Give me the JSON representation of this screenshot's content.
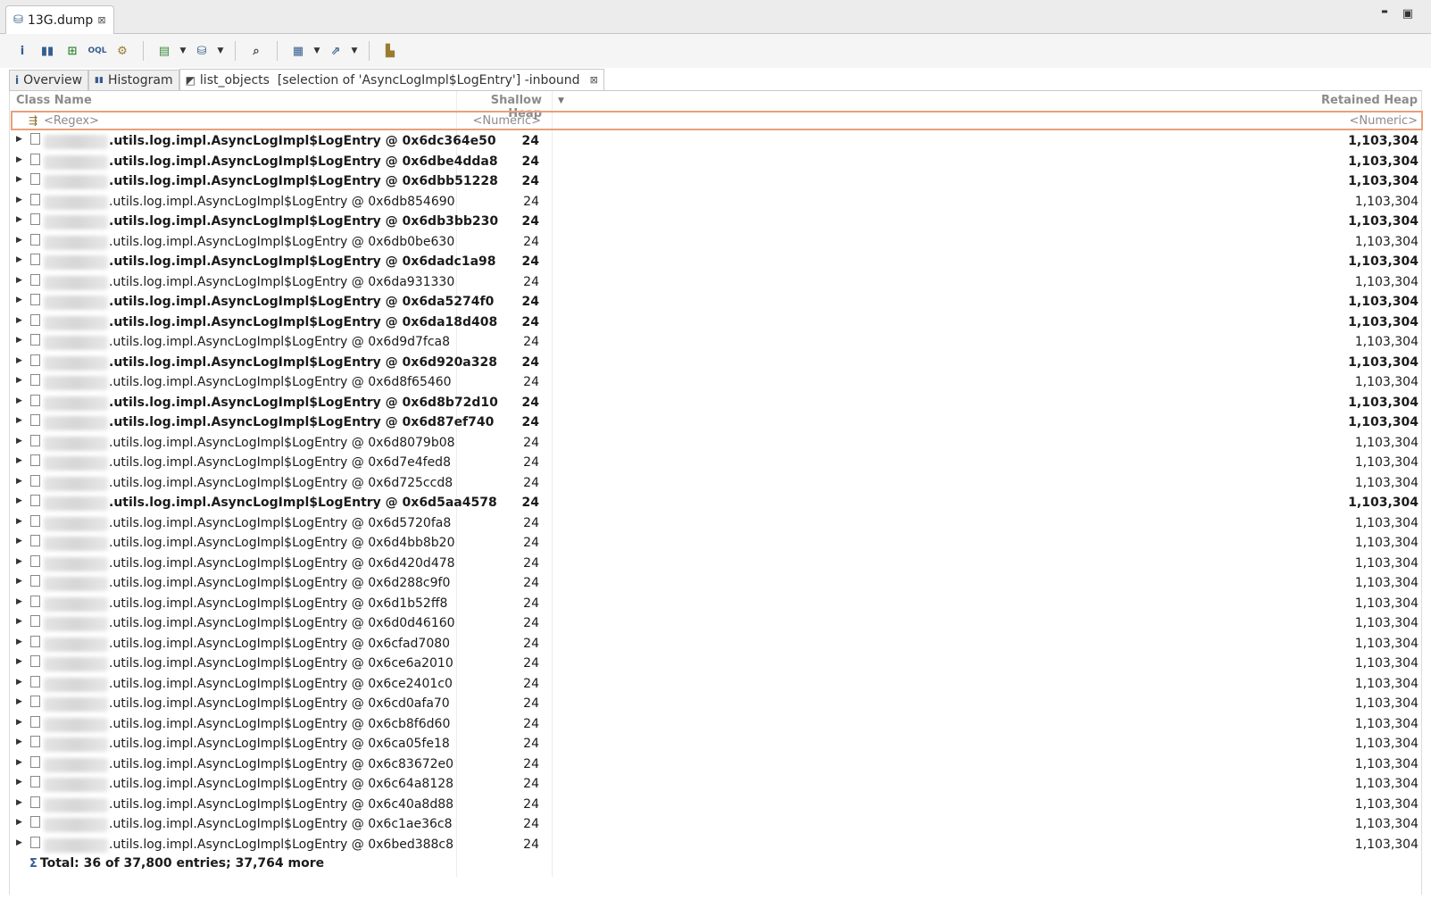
{
  "editor_tab": {
    "title": "13G.dump",
    "close": "⊠"
  },
  "window_controls": {
    "minimize": "▬",
    "maximize": "▣"
  },
  "toolbar": {
    "buttons": [
      "info-icon",
      "histogram-icon",
      "dominator-tree-icon",
      "oql-icon",
      "heap-dump-details-icon",
      "run-report-icon",
      "query-browser-icon",
      "find-object-icon",
      "calculator-icon",
      "export-icon",
      "group-icon"
    ]
  },
  "view_tabs": [
    {
      "icon": "i",
      "label": "Overview"
    },
    {
      "icon": "▮▮",
      "label": "Histogram"
    },
    {
      "icon": "◩",
      "label": "list_objects  [selection of 'AsyncLogImpl$LogEntry'] -inbound",
      "close": "⊠"
    }
  ],
  "table": {
    "headers": {
      "class_name": "Class Name",
      "shallow_heap": "Shallow Heap",
      "retained_heap": "Retained Heap",
      "sort_indicator": "▼"
    },
    "filters": {
      "class_name": "<Regex>",
      "shallow_heap": "<Numeric>",
      "retained_heap": "<Numeric>"
    },
    "rows": [
      {
        "cls": ".utils.log.impl.AsyncLogImpl$LogEntry @ 0x6dc364e50",
        "shallow": "24",
        "retained": "1,103,304",
        "bold": true
      },
      {
        "cls": ".utils.log.impl.AsyncLogImpl$LogEntry @ 0x6dbe4dda8",
        "shallow": "24",
        "retained": "1,103,304",
        "bold": true
      },
      {
        "cls": ".utils.log.impl.AsyncLogImpl$LogEntry @ 0x6dbb51228",
        "shallow": "24",
        "retained": "1,103,304",
        "bold": true
      },
      {
        "cls": ".utils.log.impl.AsyncLogImpl$LogEntry @ 0x6db854690",
        "shallow": "24",
        "retained": "1,103,304",
        "bold": false
      },
      {
        "cls": ".utils.log.impl.AsyncLogImpl$LogEntry @ 0x6db3bb230",
        "shallow": "24",
        "retained": "1,103,304",
        "bold": true
      },
      {
        "cls": ".utils.log.impl.AsyncLogImpl$LogEntry @ 0x6db0be630",
        "shallow": "24",
        "retained": "1,103,304",
        "bold": false
      },
      {
        "cls": ".utils.log.impl.AsyncLogImpl$LogEntry @ 0x6dadc1a98",
        "shallow": "24",
        "retained": "1,103,304",
        "bold": true
      },
      {
        "cls": ".utils.log.impl.AsyncLogImpl$LogEntry @ 0x6da931330",
        "shallow": "24",
        "retained": "1,103,304",
        "bold": false
      },
      {
        "cls": ".utils.log.impl.AsyncLogImpl$LogEntry @ 0x6da5274f0",
        "shallow": "24",
        "retained": "1,103,304",
        "bold": true
      },
      {
        "cls": ".utils.log.impl.AsyncLogImpl$LogEntry @ 0x6da18d408",
        "shallow": "24",
        "retained": "1,103,304",
        "bold": true
      },
      {
        "cls": ".utils.log.impl.AsyncLogImpl$LogEntry @ 0x6d9d7fca8",
        "shallow": "24",
        "retained": "1,103,304",
        "bold": false
      },
      {
        "cls": ".utils.log.impl.AsyncLogImpl$LogEntry @ 0x6d920a328",
        "shallow": "24",
        "retained": "1,103,304",
        "bold": true
      },
      {
        "cls": ".utils.log.impl.AsyncLogImpl$LogEntry @ 0x6d8f65460",
        "shallow": "24",
        "retained": "1,103,304",
        "bold": false
      },
      {
        "cls": ".utils.log.impl.AsyncLogImpl$LogEntry @ 0x6d8b72d10",
        "shallow": "24",
        "retained": "1,103,304",
        "bold": true
      },
      {
        "cls": ".utils.log.impl.AsyncLogImpl$LogEntry @ 0x6d87ef740",
        "shallow": "24",
        "retained": "1,103,304",
        "bold": true
      },
      {
        "cls": ".utils.log.impl.AsyncLogImpl$LogEntry @ 0x6d8079b08",
        "shallow": "24",
        "retained": "1,103,304",
        "bold": false
      },
      {
        "cls": ".utils.log.impl.AsyncLogImpl$LogEntry @ 0x6d7e4fed8",
        "shallow": "24",
        "retained": "1,103,304",
        "bold": false
      },
      {
        "cls": ".utils.log.impl.AsyncLogImpl$LogEntry @ 0x6d725ccd8",
        "shallow": "24",
        "retained": "1,103,304",
        "bold": false
      },
      {
        "cls": ".utils.log.impl.AsyncLogImpl$LogEntry @ 0x6d5aa4578",
        "shallow": "24",
        "retained": "1,103,304",
        "bold": true
      },
      {
        "cls": ".utils.log.impl.AsyncLogImpl$LogEntry @ 0x6d5720fa8",
        "shallow": "24",
        "retained": "1,103,304",
        "bold": false
      },
      {
        "cls": ".utils.log.impl.AsyncLogImpl$LogEntry @ 0x6d4bb8b20",
        "shallow": "24",
        "retained": "1,103,304",
        "bold": false
      },
      {
        "cls": ".utils.log.impl.AsyncLogImpl$LogEntry @ 0x6d420d478",
        "shallow": "24",
        "retained": "1,103,304",
        "bold": false
      },
      {
        "cls": ".utils.log.impl.AsyncLogImpl$LogEntry @ 0x6d288c9f0",
        "shallow": "24",
        "retained": "1,103,304",
        "bold": false
      },
      {
        "cls": ".utils.log.impl.AsyncLogImpl$LogEntry @ 0x6d1b52ff8",
        "shallow": "24",
        "retained": "1,103,304",
        "bold": false
      },
      {
        "cls": ".utils.log.impl.AsyncLogImpl$LogEntry @ 0x6d0d46160",
        "shallow": "24",
        "retained": "1,103,304",
        "bold": false
      },
      {
        "cls": ".utils.log.impl.AsyncLogImpl$LogEntry @ 0x6cfad7080",
        "shallow": "24",
        "retained": "1,103,304",
        "bold": false
      },
      {
        "cls": ".utils.log.impl.AsyncLogImpl$LogEntry @ 0x6ce6a2010",
        "shallow": "24",
        "retained": "1,103,304",
        "bold": false
      },
      {
        "cls": ".utils.log.impl.AsyncLogImpl$LogEntry @ 0x6ce2401c0",
        "shallow": "24",
        "retained": "1,103,304",
        "bold": false
      },
      {
        "cls": ".utils.log.impl.AsyncLogImpl$LogEntry @ 0x6cd0afa70",
        "shallow": "24",
        "retained": "1,103,304",
        "bold": false
      },
      {
        "cls": ".utils.log.impl.AsyncLogImpl$LogEntry @ 0x6cb8f6d60",
        "shallow": "24",
        "retained": "1,103,304",
        "bold": false
      },
      {
        "cls": ".utils.log.impl.AsyncLogImpl$LogEntry @ 0x6ca05fe18",
        "shallow": "24",
        "retained": "1,103,304",
        "bold": false
      },
      {
        "cls": ".utils.log.impl.AsyncLogImpl$LogEntry @ 0x6c83672e0",
        "shallow": "24",
        "retained": "1,103,304",
        "bold": false
      },
      {
        "cls": ".utils.log.impl.AsyncLogImpl$LogEntry @ 0x6c64a8128",
        "shallow": "24",
        "retained": "1,103,304",
        "bold": false
      },
      {
        "cls": ".utils.log.impl.AsyncLogImpl$LogEntry @ 0x6c40a8d88",
        "shallow": "24",
        "retained": "1,103,304",
        "bold": false
      },
      {
        "cls": ".utils.log.impl.AsyncLogImpl$LogEntry @ 0x6c1ae36c8",
        "shallow": "24",
        "retained": "1,103,304",
        "bold": false
      },
      {
        "cls": ".utils.log.impl.AsyncLogImpl$LogEntry @ 0x6bed388c8",
        "shallow": "24",
        "retained": "1,103,304",
        "bold": false
      }
    ],
    "total": {
      "icon": "Σ",
      "text": "Total: 36 of 37,800 entries; 37,764 more"
    }
  }
}
